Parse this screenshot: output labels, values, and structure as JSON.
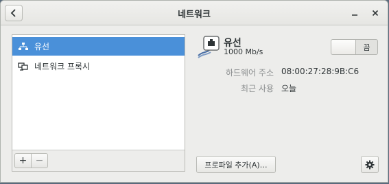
{
  "window": {
    "title": "네트워크",
    "back_icon": "chevron-left-icon",
    "minimize_label": "_",
    "close_label": "×"
  },
  "sidebar": {
    "items": [
      {
        "label": "유선",
        "icon": "wired-network-icon",
        "selected": true
      },
      {
        "label": "네트워크 프록시",
        "icon": "network-proxy-icon",
        "selected": false
      }
    ],
    "add_label": "+",
    "remove_label": "−"
  },
  "device": {
    "name": "유선",
    "speed": "1000 Mb/s",
    "switch_state": "끔",
    "hardware_address_label": "하드웨어 주소",
    "hardware_address": "08:00:27:28:9B:C6",
    "last_used_label": "최근 사용",
    "last_used": "오늘",
    "add_profile_label": "프로파일 추가(A)…",
    "settings_icon": "gear-icon"
  },
  "colors": {
    "selection": "#4a90d9",
    "window_bg": "#ededeb"
  }
}
